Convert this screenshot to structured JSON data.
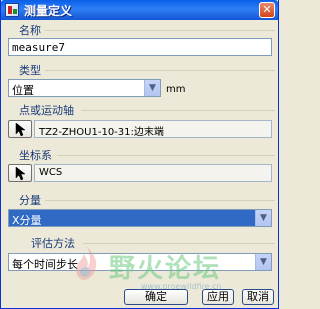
{
  "window": {
    "title": "测量定义",
    "close_symbol": "✕"
  },
  "name_group": {
    "label": "名称",
    "value": "measure7"
  },
  "type_group": {
    "label": "类型",
    "selected": "位置",
    "unit": "mm"
  },
  "point_group": {
    "label": "点或运动轴",
    "value": "TZ2-ZHOU1-10-31:边末端"
  },
  "coord_group": {
    "label": "坐标系",
    "value": "WCS"
  },
  "component_group": {
    "label": "分量",
    "selected": "X分量"
  },
  "eval_group": {
    "label": "评估方法",
    "selected": "每个时间步长"
  },
  "buttons": {
    "ok": "确定",
    "apply": "应用",
    "cancel": "取消"
  },
  "watermark": {
    "text": "野火论坛",
    "url": "www.proewildfire.cn"
  },
  "colors": {
    "title_bar": "#1356d6",
    "window_bg": "#ece9d8",
    "group_label": "#1a3a7a",
    "selection": "#316ac5"
  }
}
